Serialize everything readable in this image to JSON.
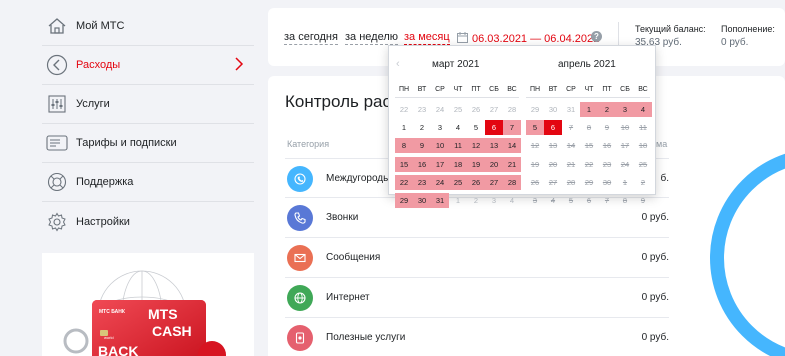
{
  "sidebar": {
    "items": [
      {
        "label": "Мой МТС",
        "icon": "home-icon"
      },
      {
        "label": "Расходы",
        "icon": "arrow-left-circle-icon",
        "active": true
      },
      {
        "label": "Услуги",
        "icon": "sliders-icon"
      },
      {
        "label": "Тарифы и подписки",
        "icon": "sim-card-icon"
      },
      {
        "label": "Поддержка",
        "icon": "lifebuoy-icon"
      },
      {
        "label": "Настройки",
        "icon": "gear-icon"
      }
    ],
    "promo": {
      "brand": "МТС БАНК",
      "line1": "MTS",
      "line2": "CASH",
      "line3": "BACK",
      "card_small": "world"
    }
  },
  "header": {
    "periods": [
      "за сегодня",
      "за неделю",
      "за месяц"
    ],
    "active_period": "за месяц",
    "date_range": "06.03.2021 — 06.04.2021",
    "help": "?",
    "balance_label": "Текущий баланс:",
    "balance_value": "35,63 руб.",
    "topup_label": "Пополнение:",
    "topup_value": "0 руб."
  },
  "main": {
    "title": "Контроль рас",
    "col_category": "Категория",
    "col_sum": "ма",
    "rows": [
      {
        "name": "Междугороды",
        "amount": "б.",
        "icon": "globe-phone-icon",
        "color": "#45b6fe"
      },
      {
        "name": "Звонки",
        "amount": "0 руб.",
        "icon": "phone-icon",
        "color": "#5978d6"
      },
      {
        "name": "Сообщения",
        "amount": "0 руб.",
        "icon": "envelope-icon",
        "color": "#ea7054"
      },
      {
        "name": "Интернет",
        "amount": "0 руб.",
        "icon": "globe-icon",
        "color": "#3fa857"
      },
      {
        "name": "Полезные услуги",
        "amount": "0 руб.",
        "icon": "service-icon",
        "color": "#e5606e"
      }
    ]
  },
  "calendar": {
    "prev_arrow": "‹",
    "weekdays": [
      "ПН",
      "ВТ",
      "СР",
      "ЧТ",
      "ПТ",
      "СБ",
      "ВС"
    ],
    "months": [
      {
        "title": "март 2021",
        "weeks": [
          [
            {
              "d": "22",
              "s": "out"
            },
            {
              "d": "23",
              "s": "out"
            },
            {
              "d": "24",
              "s": "out"
            },
            {
              "d": "25",
              "s": "out"
            },
            {
              "d": "26",
              "s": "out"
            },
            {
              "d": "27",
              "s": "out"
            },
            {
              "d": "28",
              "s": "out"
            }
          ],
          [
            {
              "d": "1",
              "s": "norm"
            },
            {
              "d": "2",
              "s": "norm"
            },
            {
              "d": "3",
              "s": "norm"
            },
            {
              "d": "4",
              "s": "norm"
            },
            {
              "d": "5",
              "s": "norm"
            },
            {
              "d": "6",
              "s": "edge"
            },
            {
              "d": "7",
              "s": "sel"
            }
          ],
          [
            {
              "d": "8",
              "s": "sel"
            },
            {
              "d": "9",
              "s": "sel"
            },
            {
              "d": "10",
              "s": "sel"
            },
            {
              "d": "11",
              "s": "sel"
            },
            {
              "d": "12",
              "s": "sel"
            },
            {
              "d": "13",
              "s": "sel"
            },
            {
              "d": "14",
              "s": "sel"
            }
          ],
          [
            {
              "d": "15",
              "s": "sel"
            },
            {
              "d": "16",
              "s": "sel"
            },
            {
              "d": "17",
              "s": "sel"
            },
            {
              "d": "18",
              "s": "sel"
            },
            {
              "d": "19",
              "s": "sel"
            },
            {
              "d": "20",
              "s": "sel"
            },
            {
              "d": "21",
              "s": "sel"
            }
          ],
          [
            {
              "d": "22",
              "s": "sel"
            },
            {
              "d": "23",
              "s": "sel"
            },
            {
              "d": "24",
              "s": "sel"
            },
            {
              "d": "25",
              "s": "sel"
            },
            {
              "d": "26",
              "s": "sel"
            },
            {
              "d": "27",
              "s": "sel"
            },
            {
              "d": "28",
              "s": "sel"
            }
          ],
          [
            {
              "d": "29",
              "s": "sel"
            },
            {
              "d": "30",
              "s": "sel"
            },
            {
              "d": "31",
              "s": "sel"
            },
            {
              "d": "1",
              "s": "out"
            },
            {
              "d": "2",
              "s": "out"
            },
            {
              "d": "3",
              "s": "out"
            },
            {
              "d": "4",
              "s": "out"
            }
          ]
        ]
      },
      {
        "title": "апрель 2021",
        "weeks": [
          [
            {
              "d": "29",
              "s": "out"
            },
            {
              "d": "30",
              "s": "out"
            },
            {
              "d": "31",
              "s": "out"
            },
            {
              "d": "1",
              "s": "sel"
            },
            {
              "d": "2",
              "s": "sel"
            },
            {
              "d": "3",
              "s": "sel"
            },
            {
              "d": "4",
              "s": "sel"
            }
          ],
          [
            {
              "d": "5",
              "s": "sel"
            },
            {
              "d": "6",
              "s": "edge"
            },
            {
              "d": "7",
              "s": "dis"
            },
            {
              "d": "8",
              "s": "dis"
            },
            {
              "d": "9",
              "s": "dis"
            },
            {
              "d": "10",
              "s": "dis"
            },
            {
              "d": "11",
              "s": "dis"
            }
          ],
          [
            {
              "d": "12",
              "s": "dis"
            },
            {
              "d": "13",
              "s": "dis"
            },
            {
              "d": "14",
              "s": "dis"
            },
            {
              "d": "15",
              "s": "dis"
            },
            {
              "d": "16",
              "s": "dis"
            },
            {
              "d": "17",
              "s": "dis"
            },
            {
              "d": "18",
              "s": "dis"
            }
          ],
          [
            {
              "d": "19",
              "s": "dis"
            },
            {
              "d": "20",
              "s": "dis"
            },
            {
              "d": "21",
              "s": "dis"
            },
            {
              "d": "22",
              "s": "dis"
            },
            {
              "d": "23",
              "s": "dis"
            },
            {
              "d": "24",
              "s": "dis"
            },
            {
              "d": "25",
              "s": "dis"
            }
          ],
          [
            {
              "d": "26",
              "s": "dis"
            },
            {
              "d": "27",
              "s": "dis"
            },
            {
              "d": "28",
              "s": "dis"
            },
            {
              "d": "29",
              "s": "dis"
            },
            {
              "d": "30",
              "s": "dis"
            },
            {
              "d": "1",
              "s": "dis"
            },
            {
              "d": "2",
              "s": "dis"
            }
          ],
          [
            {
              "d": "3",
              "s": "dis"
            },
            {
              "d": "4",
              "s": "dis"
            },
            {
              "d": "5",
              "s": "dis"
            },
            {
              "d": "6",
              "s": "dis"
            },
            {
              "d": "7",
              "s": "dis"
            },
            {
              "d": "8",
              "s": "dis"
            },
            {
              "d": "9",
              "s": "dis"
            }
          ]
        ]
      }
    ]
  },
  "colors": {
    "accent": "#e30611",
    "range": "#f19aa3",
    "ring": "#45b6fe"
  }
}
